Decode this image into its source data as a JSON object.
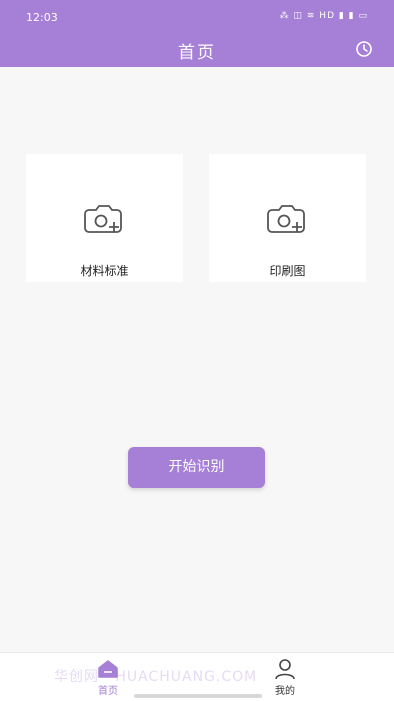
{
  "status_bar": {
    "time": "12:03",
    "icons_text": "⁂ ◫ ≋ HD ▮ ▮ ▭"
  },
  "header": {
    "title": "首页",
    "right_icon": "history-icon"
  },
  "cards": [
    {
      "label": "材料标准",
      "icon": "camera-add-icon"
    },
    {
      "label": "印刷图",
      "icon": "camera-add-icon"
    }
  ],
  "actions": {
    "start_label": "开始识别"
  },
  "tabbar": {
    "tabs": [
      {
        "label": "首页",
        "icon": "home-icon",
        "active": true
      },
      {
        "label": "我的",
        "icon": "user-icon",
        "active": false
      }
    ]
  },
  "watermark": "华创网 · HUACHUANG.COM",
  "colors": {
    "accent": "#a67fd6",
    "background": "#f7f7f7"
  }
}
